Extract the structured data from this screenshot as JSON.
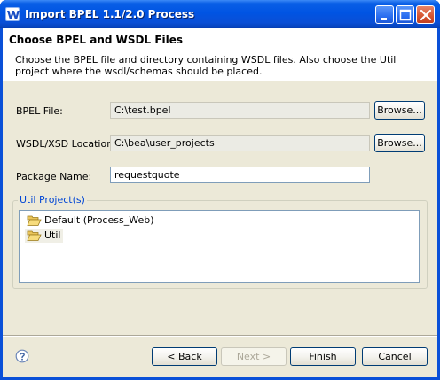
{
  "window": {
    "title": "Import BPEL 1.1/2.0 Process"
  },
  "header": {
    "title": "Choose BPEL and WSDL Files",
    "description": "Choose the BPEL file and directory containing WSDL files. Also choose the Util project where the wsdl/schemas should be placed."
  },
  "form": {
    "bpel_file_label": "BPEL File:",
    "bpel_file_value": "C:\\test.bpel",
    "wsdl_location_label": "WSDL/XSD Location:",
    "wsdl_location_value": "C:\\bea\\user_projects",
    "package_name_label": "Package Name:",
    "package_name_value": "requestquote",
    "browse_label": "Browse..."
  },
  "util_projects": {
    "label": "Util Project(s)",
    "items": [
      {
        "label": "Default (Process_Web)",
        "icon": "folder-open-icon"
      },
      {
        "label": "Util",
        "icon": "folder-open-icon"
      }
    ]
  },
  "footer": {
    "help_icon": "help-icon",
    "back_label": "< Back",
    "next_label": "Next >",
    "finish_label": "Finish",
    "cancel_label": "Cancel"
  },
  "colors": {
    "titlebar": "#0054e3",
    "dialog_bg": "#ece9d8",
    "group_label": "#0046d5"
  }
}
